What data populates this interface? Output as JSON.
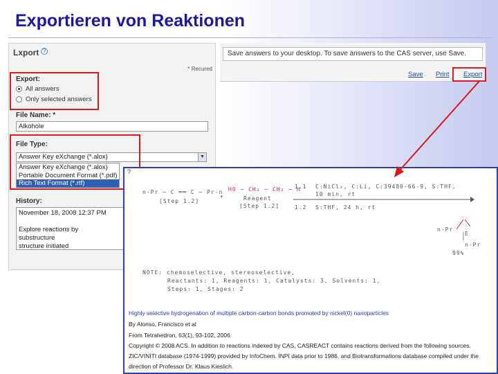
{
  "slide": {
    "title": "Exportieren von Reaktionen"
  },
  "export_panel": {
    "heading": "Lxport",
    "required_note": "* Recured",
    "export_label": "Export:",
    "options": [
      {
        "label": "All answers",
        "checked": true
      },
      {
        "label": "Only selected answers",
        "checked": false
      }
    ],
    "file_name_label": "File Name: *",
    "file_name_value": "Alkohole",
    "file_type_label": "File Type:",
    "file_type_selected": "Answer Key eXchange (*.alox)",
    "file_type_options": [
      {
        "label": "Answer Key eXchange (*.alox)",
        "selected": false
      },
      {
        "label": "Portable Document Format (*.pdf)",
        "selected": false
      },
      {
        "label": "Rich Text Format (*.rtf)",
        "selected": true
      }
    ],
    "history_label": "History:",
    "history_lines": [
      "November 18, 2008 12:37 PM",
      "",
      "Explore reactions by",
      "substructure",
      "structure initiated"
    ]
  },
  "toolbar": {
    "message": "Save answers to your desktop. To save answers to the CAS server, use Save.",
    "links": [
      "Save",
      "Print",
      "Export"
    ]
  },
  "doc_preview": {
    "question_mark": "?",
    "reactant": "n-Pr ─ C ══ C ─ Pr-n",
    "step_left": "[Step 1.2]",
    "plus": "+",
    "reagent_formula": "HO ─ CH₂ ─ CH₂ ─ H",
    "reagent_label": "Reagent",
    "reagent_step": "[Step 1.2]",
    "condition_1_num": "1.1",
    "condition_1": "C:NiCl₂, C:Li, C:39480-66-9, S:THF,",
    "condition_1b": "10 min, rt",
    "condition_2_num": "1.2",
    "condition_2": "S:THF, 24 h, rt",
    "product_top": "n-Pr",
    "product_bottom": "n-Pr",
    "product_ring": "E",
    "yield": "99%",
    "notes_1": "NOTE: chemoselective, stereoselective,",
    "notes_2": "Reactants: 1, Reagents: 1, Catalysts: 3, Solvents: 1,",
    "notes_3": "Steps: 1, Stages: 2",
    "article_title": "Highly selective hydrogenation of multiple carbon-carbon bonds promoted by nickel(0) nanoparticles",
    "authors": "By Alonso, Francisco et al",
    "source": "From Tetrahedron, 63(1), 93-102, 2006",
    "copyright": "Copyright © 2008 ACS. In addition to reactions indexed by CAS, CASREACT contains reactions derived from the following sources.",
    "zic": "ZIC/VINITI database (1974-1999) provided by InfoChem. INPI data prior to 1986, and Biotransformations database compiled under the",
    "direction": "direction of Professor Dr. Klaus Kieslich."
  },
  "colors": {
    "title": "#1a1aa0",
    "highlight": "#e01a1a",
    "preview_border": "#2a3fb0",
    "arrow": "#d81818"
  }
}
